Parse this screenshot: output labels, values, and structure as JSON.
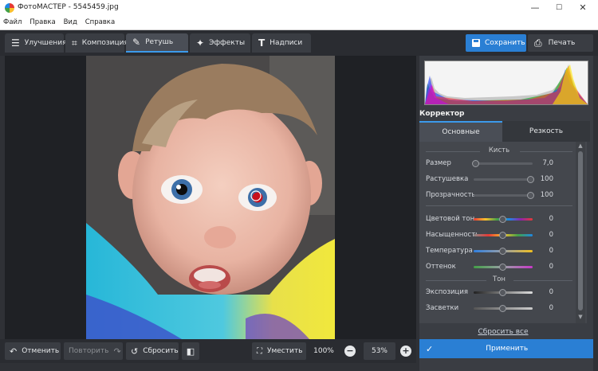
{
  "window": {
    "title": "ФотоМАСТЕР - 5545459.jpg",
    "minimize": "—",
    "maximize": "☐",
    "close": "✕"
  },
  "menu": [
    "Файл",
    "Правка",
    "Вид",
    "Справка"
  ],
  "tabs": [
    {
      "label": "Улучшения",
      "icon": "sliders-icon"
    },
    {
      "label": "Композиция",
      "icon": "crop-icon"
    },
    {
      "label": "Ретушь",
      "icon": "brush-icon",
      "active": true
    },
    {
      "label": "Эффекты",
      "icon": "magic-wand-icon"
    },
    {
      "label": "Надписи",
      "icon": "text-icon"
    }
  ],
  "toolbar": {
    "save_label": "Сохранить",
    "print_label": "Печать"
  },
  "panel": {
    "section_title": "Корректор",
    "tabs": [
      "Основные",
      "Резкость"
    ],
    "brush_group": "Кисть",
    "brush_rows": [
      {
        "label": "Размер",
        "value": "7,0",
        "level": 0.05
      },
      {
        "label": "Растушевка",
        "value": "100",
        "level": 1.0
      },
      {
        "label": "Прозрачность",
        "value": "100",
        "level": 1.0
      }
    ],
    "color_rows": [
      {
        "label": "Цветовой тон",
        "value": "0",
        "level": 0.5
      },
      {
        "label": "Насыщенность",
        "value": "0",
        "level": 0.5
      },
      {
        "label": "Температура",
        "value": "0",
        "level": 0.5
      },
      {
        "label": "Оттенок",
        "value": "0",
        "level": 0.5
      }
    ],
    "tone_group": "Тон",
    "tone_rows": [
      {
        "label": "Экспозиция",
        "value": "0",
        "level": 0.5
      },
      {
        "label": "Засветки",
        "value": "0",
        "level": 0.5
      }
    ],
    "reset_all": "Сбросить все",
    "apply_label": "Применить"
  },
  "bottom": {
    "undo_label": "Отменить",
    "redo_label": "Повторить",
    "reset_label": "Сбросить",
    "fit_label": "Уместить",
    "zoom_100": "100%",
    "zoom_current": "53%",
    "zoom_out": "−",
    "zoom_in": "+"
  },
  "colors": {
    "accent": "#2a7fd4",
    "panel_bg": "#3a3d43",
    "app_bg": "#2f3136"
  }
}
